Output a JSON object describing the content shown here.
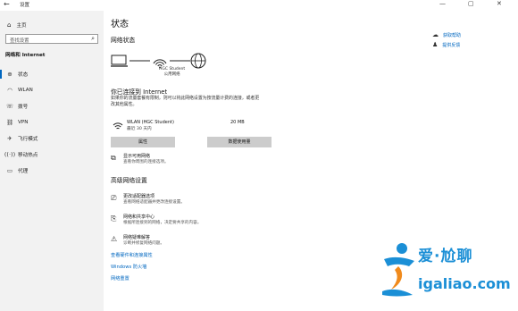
{
  "window": {
    "title": "设置",
    "back_icon": "back-arrow-icon",
    "controls": [
      "—",
      "▢",
      "✕"
    ]
  },
  "sidebar": {
    "home_label": "主页",
    "search_placeholder": "查找设置",
    "section_title": "网络和 Internet",
    "items": [
      {
        "label": "状态",
        "icon": "status-icon",
        "active": true
      },
      {
        "label": "WLAN",
        "icon": "wifi-icon",
        "active": false
      },
      {
        "label": "拨号",
        "icon": "dialup-icon",
        "active": false
      },
      {
        "label": "VPN",
        "icon": "vpn-icon",
        "active": false
      },
      {
        "label": "飞行模式",
        "icon": "airplane-icon",
        "active": false
      },
      {
        "label": "移动热点",
        "icon": "hotspot-icon",
        "active": false
      },
      {
        "label": "代理",
        "icon": "proxy-icon",
        "active": false
      }
    ]
  },
  "main": {
    "title": "状态",
    "network_status_heading": "网络状态",
    "network_name": "HGC Student",
    "network_type": "公用网络",
    "connected_title": "你已连接到 Internet",
    "connected_desc": "如果你的流量套餐有限制，则可以将此网络设置为按流量计费的连接，或者更改其他属性。",
    "wlan": {
      "name": "WLAN (HGC Student)",
      "usage": "最近 30 天内",
      "size": "20 MB"
    },
    "buttons": {
      "properties": "属性",
      "data_usage": "数据使用量"
    },
    "show_networks": {
      "title": "显示可用网络",
      "desc": "查看你周围的连接选项。"
    },
    "advanced_heading": "高级网络设置",
    "advanced_items": [
      {
        "title": "更改适配器选项",
        "desc": "查看网络适配器并更改连接设置。",
        "icon": "adapter-icon"
      },
      {
        "title": "网络和共享中心",
        "desc": "根据所连接到的网络，决定要共享的内容。",
        "icon": "sharing-icon"
      },
      {
        "title": "网络疑难解答",
        "desc": "诊断并修复网络问题。",
        "icon": "warning-icon"
      }
    ],
    "links": [
      "查看硬件和连接属性",
      "Windows 防火墙",
      "网络重置"
    ]
  },
  "right": {
    "links": [
      {
        "label": "获取帮助",
        "icon": "help-icon"
      },
      {
        "label": "提供反馈",
        "icon": "feedback-icon"
      }
    ]
  },
  "watermark": {
    "line1": "爱·尬聊",
    "line2": "igaliao.com"
  },
  "colors": {
    "accent": "#0067c0",
    "sidebar_bg": "#f2f2f2",
    "button_bg": "#cccccc",
    "watermark_blue": "#1b8fd6",
    "watermark_orange": "#f08a1c"
  }
}
